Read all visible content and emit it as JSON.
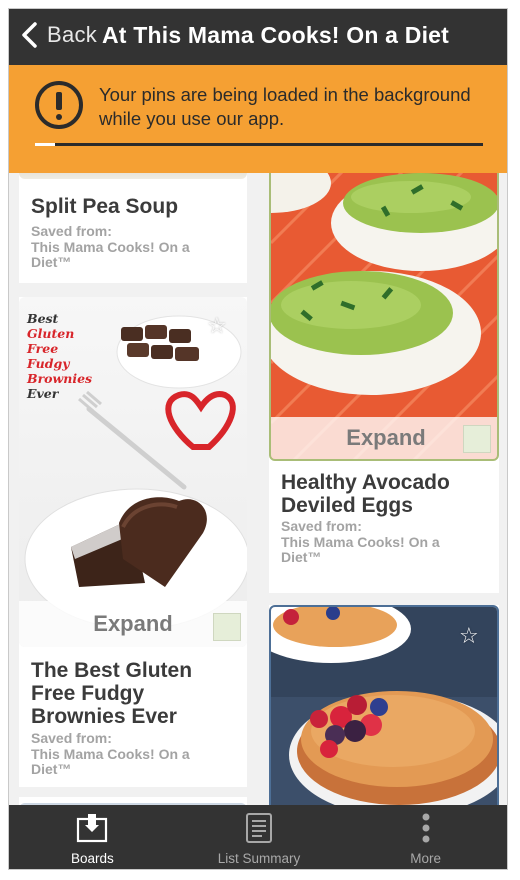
{
  "navbar": {
    "back_label": "Back",
    "title": "At This Mama Cooks! On a Diet"
  },
  "banner": {
    "message": "Your pins are being loaded in the background while you use our app.",
    "icon": "alert-circle-icon",
    "progress": 0.045,
    "background_color": "#f5a033"
  },
  "pins": [
    {
      "title": "Split Pea Soup",
      "saved_label": "Saved from:",
      "source": "This Mama Cooks! On a Diet™"
    },
    {
      "image_text": [
        "Best",
        "Gluten",
        "Free",
        "Fudgy",
        "Brownies",
        "Ever"
      ],
      "expand_label": "Expand",
      "title": "The Best Gluten Free Fudgy Brownies Ever",
      "saved_label": "Saved from:",
      "source": "This Mama Cooks! On a Diet™"
    },
    {
      "expand_label": "Expand",
      "title": "Healthy Avocado Deviled Eggs",
      "saved_label": "Saved from:",
      "source": "This Mama Cooks! On a Diet™"
    },
    {
      "title": "",
      "icon": "star-icon"
    }
  ],
  "tabs": [
    {
      "label": "Boards",
      "icon": "boards-icon",
      "active": true
    },
    {
      "label": "List Summary",
      "icon": "list-icon",
      "active": false
    },
    {
      "label": "More",
      "icon": "more-vertical-icon",
      "active": false
    }
  ],
  "colors": {
    "navbar": "#333333",
    "banner": "#f5a033",
    "title_text": "#3b3b3b",
    "muted_text": "#a3a3a3"
  }
}
